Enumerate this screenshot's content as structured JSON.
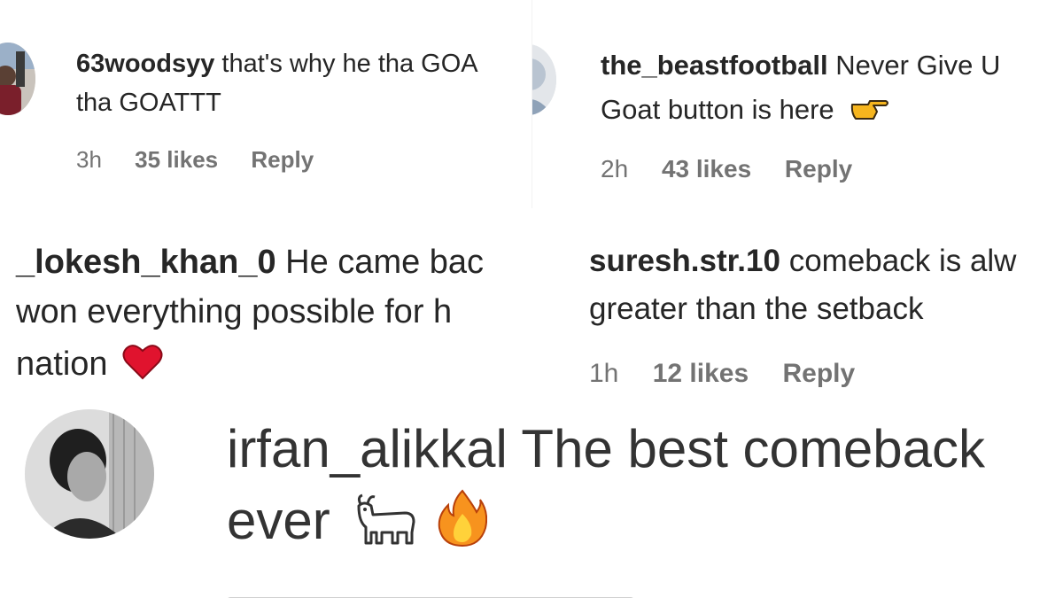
{
  "comments": [
    {
      "username": "63woodsyy",
      "line1": "that's why he tha GOA",
      "line2": "tha GOATTT",
      "time": "3h",
      "likes": "35 likes",
      "reply": "Reply",
      "avatar_icon": "user-avatar-icon"
    },
    {
      "username": "the_beastfootball",
      "line1": "Never Give U",
      "line2": "Goat button is here",
      "emoji_icon": "backhand-index-pointing-right-icon",
      "time": "2h",
      "likes": "43 likes",
      "reply": "Reply",
      "avatar_icon": "user-avatar-icon"
    },
    {
      "username": "_lokesh_khan_0",
      "line1": "He came bac",
      "line2": "won everything possible for h",
      "line3": "nation",
      "emoji_icon": "red-heart-icon"
    },
    {
      "username": "suresh.str.10",
      "line1": "comeback is alw",
      "line2": "greater than the setback",
      "time": "1h",
      "likes": "12 likes",
      "reply": "Reply"
    },
    {
      "username": "irfan_alikkal",
      "line1": "The best comeback",
      "line2": "ever",
      "emoji_icons": [
        "goat-icon",
        "fire-icon"
      ],
      "avatar_icon": "user-avatar-icon"
    }
  ],
  "colors": {
    "text": "#262626",
    "meta": "#737373",
    "heart": "#e0132e",
    "fire": "#f7931e",
    "pointing_hand": "#f6b51e"
  }
}
